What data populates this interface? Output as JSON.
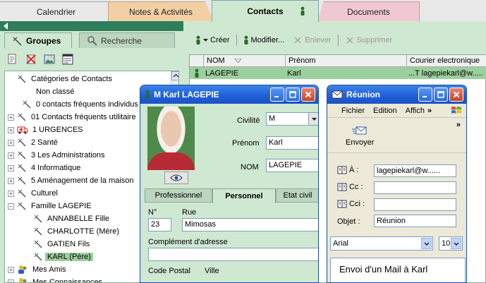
{
  "tabs": {
    "calendrier": "Calendrier",
    "notes": "Notes & Activités",
    "contacts": "Contacts",
    "documents": "Documents"
  },
  "left": {
    "tab_groupes": "Groupes",
    "tab_recherche": "Recherche",
    "tree": [
      {
        "label": "Catégories de Contacts",
        "level": 0,
        "expander": "",
        "icon": "pin-icon"
      },
      {
        "label": "Non classé",
        "level": 1,
        "expander": "",
        "icon": ""
      },
      {
        "label": "0 contacts fréquents individus",
        "level": 1,
        "expander": "",
        "icon": "pin-icon"
      },
      {
        "label": "01 Contacts  fréquents utilitaire",
        "level": 0,
        "expander": "+",
        "icon": "pin-icon"
      },
      {
        "label": "1 URGENCES",
        "level": 0,
        "expander": "+",
        "icon": "ambulance-icon"
      },
      {
        "label": "2 Santé",
        "level": 0,
        "expander": "+",
        "icon": "pin-icon"
      },
      {
        "label": "3  Les Administrations",
        "level": 0,
        "expander": "+",
        "icon": "pin-icon"
      },
      {
        "label": "4 Informatique",
        "level": 0,
        "expander": "+",
        "icon": "pin-icon"
      },
      {
        "label": "5 Aménagement de la maison",
        "level": 0,
        "expander": "+",
        "icon": "pin-icon"
      },
      {
        "label": "Culturel",
        "level": 0,
        "expander": "+",
        "icon": "pin-icon"
      },
      {
        "label": "Famille LAGEPIE",
        "level": 0,
        "expander": "−",
        "icon": "pin-icon"
      },
      {
        "label": "ANNABELLE Fille",
        "level": 2,
        "expander": "",
        "icon": "pin-icon"
      },
      {
        "label": "CHARLOTTE (Mère)",
        "level": 2,
        "expander": "",
        "icon": "pin-icon"
      },
      {
        "label": "GATIEN Fils",
        "level": 2,
        "expander": "",
        "icon": "pin-icon"
      },
      {
        "label": "KARL  (Père)",
        "level": 2,
        "expander": "",
        "icon": "pin-icon",
        "selected": true
      },
      {
        "label": "Mes Amis",
        "level": 0,
        "expander": "+",
        "icon": "people-icon"
      },
      {
        "label": "Mes Connaissances",
        "level": 0,
        "expander": "+",
        "icon": "people-icon"
      }
    ]
  },
  "toolbar": {
    "creer": "Créer",
    "modifier": "Modifier...",
    "enlever": "Enlever",
    "supprimer": "Supprimer"
  },
  "grid": {
    "headers": {
      "nom": "NOM",
      "prenom": "Prénom",
      "courrier": "Courier electronique"
    },
    "row": {
      "nom": "LAGEPIE",
      "prenom": "Karl",
      "courrier": "...T lagepiekarl@w....."
    }
  },
  "contact_window": {
    "title": "M Karl LAGEPIE",
    "civilite_label": "Civilité",
    "civilite_value": "M",
    "prenom_label": "Prénom",
    "prenom_value": "Karl",
    "nom_label": "NOM",
    "nom_value": "LAGEPIE",
    "tabs": {
      "professionnel": "Professionnel",
      "personnel": "Personnel",
      "etat_civil": "Etat civil"
    },
    "no_label": "N°",
    "no_value": "23",
    "rue_label": "Rue",
    "rue_value": "Mimosas",
    "complement_label": "Complément d'adresse",
    "complement_value": "",
    "cp_label": "Code Postal",
    "ville_label": "Ville"
  },
  "meeting_window": {
    "title": "Réunion",
    "menu": {
      "fichier": "Fichier",
      "edition": "Edition",
      "affichage": "Affich",
      "more": "»"
    },
    "send_label": "Envoyer",
    "chevron": "»",
    "a_label": "À :",
    "a_value": "lagepiekarl@w......",
    "cc_label": "Cc :",
    "cci_label": "Cci :",
    "objet_label": "Objet :",
    "objet_value": "Réunion",
    "font_name": "Arial",
    "font_size": "10",
    "body_text": "Envoi d'un Mail à Karl"
  }
}
